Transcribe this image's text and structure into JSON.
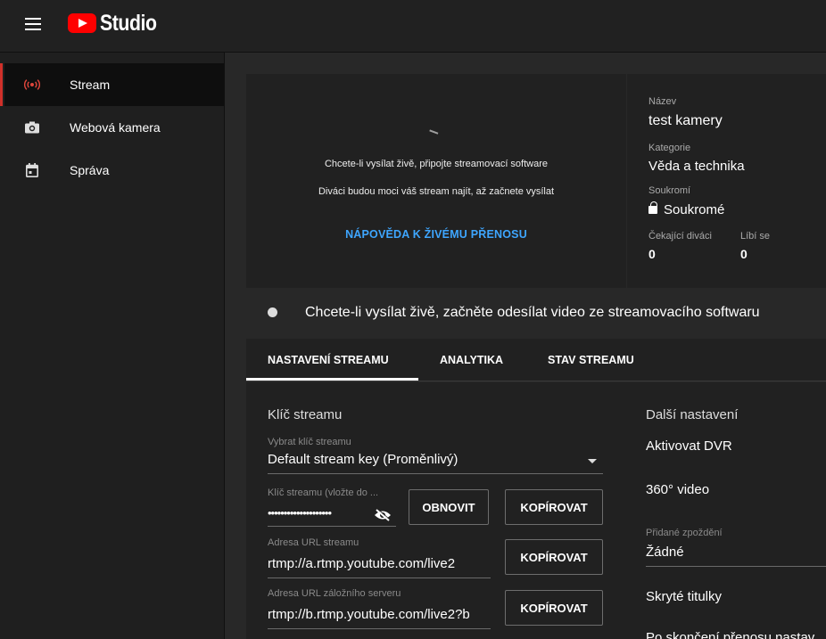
{
  "app": {
    "logo_text": "Studio"
  },
  "sidebar": {
    "items": [
      {
        "label": "Stream",
        "icon": "live-broadcast-icon"
      },
      {
        "label": "Webová kamera",
        "icon": "camera-icon"
      },
      {
        "label": "Správa",
        "icon": "calendar-icon"
      }
    ],
    "active_color": "#d0302a"
  },
  "preview": {
    "line1": "Chcete-li vysílat živě, připojte streamovací software",
    "line2": "Diváci budou moci váš stream najít, až začnete vysílat",
    "help_link": "NÁPOVĚDA K ŽIVÉMU PŘENOSU"
  },
  "info": {
    "title_label": "Název",
    "title_value": "test kamery",
    "category_label": "Kategorie",
    "category_value": "Věda a technika",
    "privacy_label": "Soukromí",
    "privacy_value": "Soukromé",
    "waiting_label": "Čekající diváci",
    "waiting_value": "0",
    "likes_label": "Líbí se",
    "likes_value": "0"
  },
  "status": {
    "text": "Chcete-li vysílat živě, začněte odesílat video ze streamovacího softwaru"
  },
  "tabs": [
    {
      "label": "NASTAVENÍ STREAMU",
      "active": true
    },
    {
      "label": "ANALYTIKA",
      "active": false
    },
    {
      "label": "STAV STREAMU",
      "active": false
    }
  ],
  "stream_key": {
    "section_title": "Klíč streamu",
    "select_label": "Vybrat klíč streamu",
    "select_value": "Default stream key (Proměnlivý)",
    "key_label": "Klíč streamu (vložte do ...",
    "key_value": "••••••••••••••••••••",
    "refresh_button": "OBNOVIT",
    "copy_button": "KOPÍROVAT",
    "url_label": "Adresa URL streamu",
    "url_value": "rtmp://a.rtmp.youtube.com/live2",
    "backup_label": "Adresa URL záložního serveru",
    "backup_value": "rtmp://b.rtmp.youtube.com/live2?b"
  },
  "more_settings": {
    "section_title": "Další nastavení",
    "dvr": "Aktivovat DVR",
    "video360": "360° video",
    "delay_label": "Přidané zpoždění",
    "delay_value": "Žádné",
    "captions": "Skryté titulky",
    "after_stream": "Po skončení přenosu nastav"
  }
}
